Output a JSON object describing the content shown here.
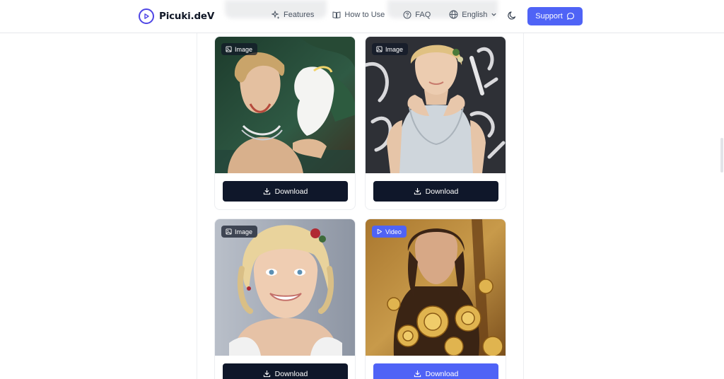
{
  "brand": {
    "name": "Picuki.deV",
    "logo_icon": "play-circle-icon"
  },
  "nav": {
    "items": [
      {
        "label": "Features",
        "icon": "sparkles-icon"
      },
      {
        "label": "How to Use",
        "icon": "book-icon"
      },
      {
        "label": "FAQ",
        "icon": "help-circle-icon"
      }
    ],
    "language": {
      "label": "English",
      "icon": "globe-icon",
      "caret": "chevron-down-icon"
    },
    "theme_icon": "moon-icon",
    "support": {
      "label": "Support",
      "icon": "chat-bubble-icon"
    }
  },
  "colors": {
    "accent": "#4f63f6",
    "dark_button": "#0f172a",
    "brand_ring": "#4f46e5"
  },
  "cards": [
    {
      "type_label": "Image",
      "type_icon": "image-icon",
      "download_label": "Download",
      "download_icon": "download-icon",
      "button_style": "dark"
    },
    {
      "type_label": "Image",
      "type_icon": "image-icon",
      "download_label": "Download",
      "download_icon": "download-icon",
      "button_style": "dark"
    },
    {
      "type_label": "Image",
      "type_icon": "image-icon",
      "download_label": "Download",
      "download_icon": "download-icon",
      "button_style": "dark"
    },
    {
      "type_label": "Video",
      "type_icon": "play-icon",
      "download_label": "Download",
      "download_icon": "download-icon",
      "button_style": "accent"
    }
  ]
}
